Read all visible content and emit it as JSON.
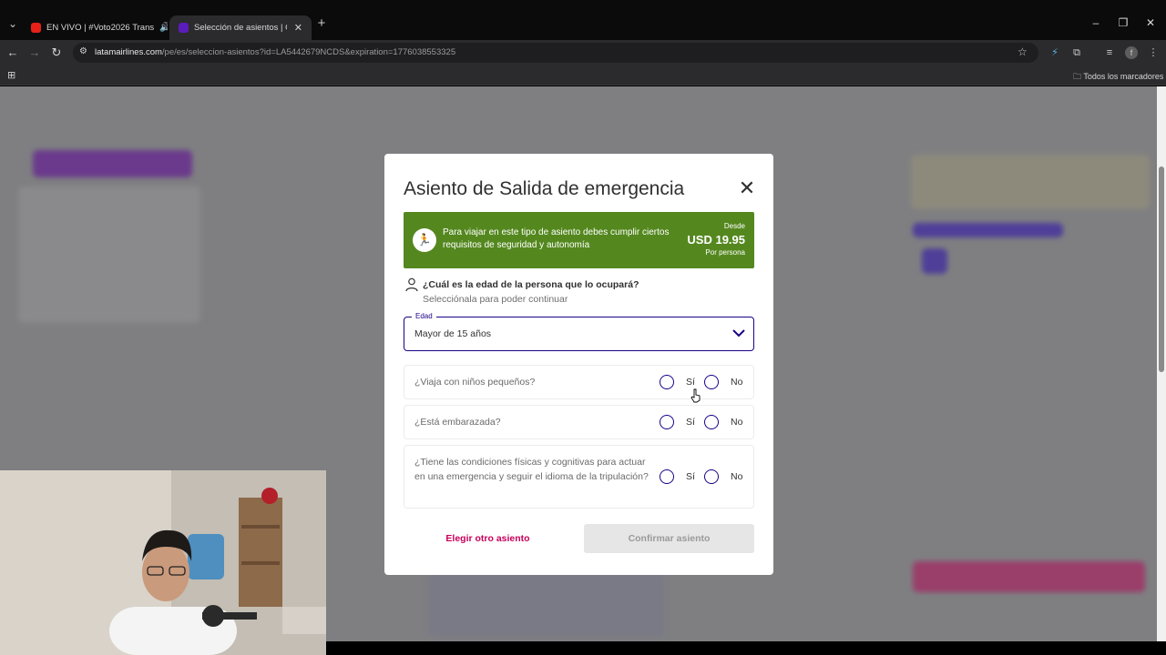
{
  "browser": {
    "tabs": [
      {
        "title": "EN VIVO | #Voto2026 Trans",
        "active": false
      },
      {
        "title": "Selección de asientos | Compra",
        "active": true
      }
    ],
    "url_domain": "latamairlines.com",
    "url_path": "/pe/es/seleccion-asientos?id=LA5442679NCDS&expiration=1776038553325",
    "bookmarks_label": "Todos los marcadores",
    "profile_initial": "f"
  },
  "modal": {
    "title": "Asiento de Salida de emergencia",
    "banner": {
      "text": "Para viajar en este tipo de asiento debes cumplir ciertos requisitos de seguridad y autonomía",
      "from_label": "Desde",
      "price": "USD 19.95",
      "per_label": "Por persona",
      "color": "#54881f"
    },
    "age_question": "¿Cuál es la edad de la persona que lo ocupará?",
    "age_hint": "Selecciónala para poder continuar",
    "age_select": {
      "label": "Edad",
      "value": "Mayor de 15 años"
    },
    "questions": [
      {
        "text": "¿Viaja con niños pequeños?",
        "yes": "Sí",
        "no": "No"
      },
      {
        "text": "¿Está embarazada?",
        "yes": "Sí",
        "no": "No"
      },
      {
        "text": "¿Tiene las condiciones físicas y cognitivas para actuar en una emergencia y seguir el idioma de la tripulación?",
        "yes": "Sí",
        "no": "No"
      }
    ],
    "secondary_button": "Elegir otro asiento",
    "primary_button": "Confirmar asiento",
    "accent_color": "#1b0088",
    "link_color": "#c8005a"
  }
}
